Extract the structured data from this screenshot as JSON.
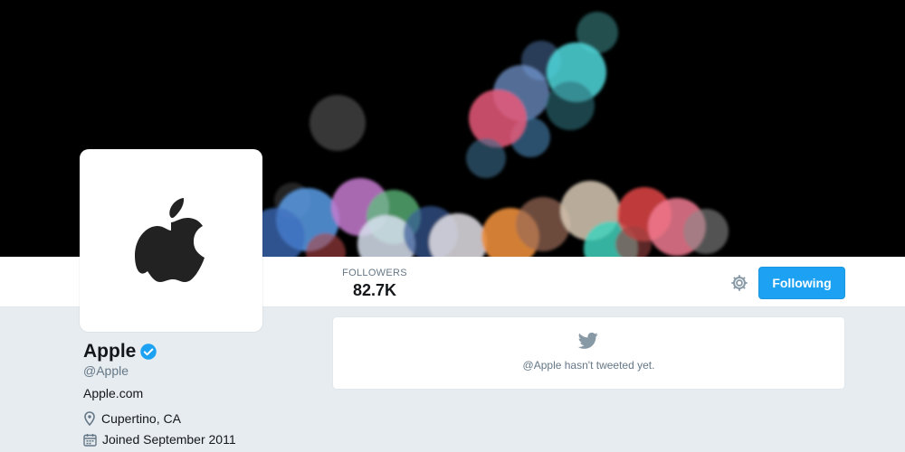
{
  "profile": {
    "name": "Apple",
    "handle": "@Apple",
    "website": "Apple.com",
    "location": "Cupertino, CA",
    "joined": "Joined September 2011",
    "verified": true
  },
  "stats": {
    "followers_label": "FOLLOWERS",
    "followers_value": "82.7K"
  },
  "actions": {
    "following_label": "Following"
  },
  "timeline": {
    "empty_message": "@Apple hasn't tweeted yet."
  },
  "icons": {
    "settings": "gear-icon",
    "verified": "verified-badge-icon",
    "location": "location-pin-icon",
    "calendar": "calendar-icon",
    "bird": "twitter-bird-icon",
    "logo": "apple-logo-icon"
  },
  "colors": {
    "accent": "#1da1f2",
    "page_background": "#e6ecf0",
    "muted_text": "#657786",
    "banner_background": "#000000"
  }
}
